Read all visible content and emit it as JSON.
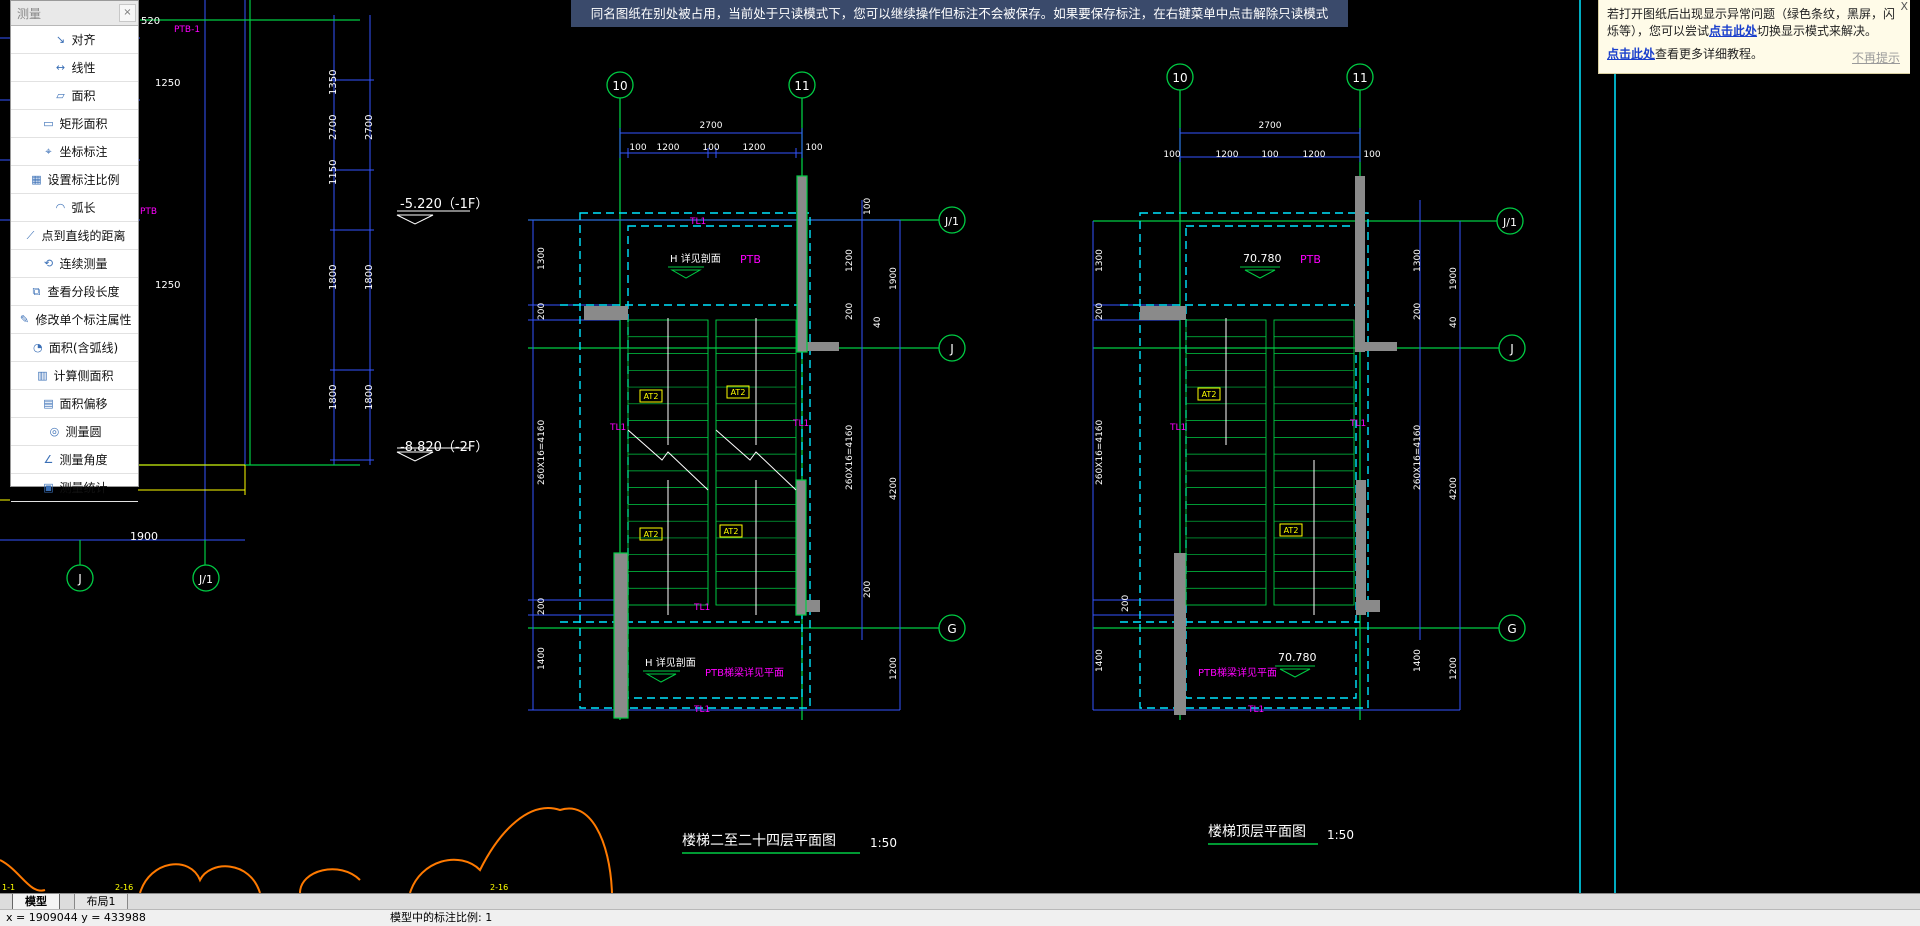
{
  "banner": {
    "text": "同名图纸在别处被占用，当前处于只读模式下，您可以继续操作但标注不会被保存。如果要保存标注，在右键菜单中点击解除只读模式"
  },
  "panel": {
    "title": "测量",
    "close": "×",
    "tools": [
      "对齐",
      "线性",
      "面积",
      "矩形面积",
      "坐标标注",
      "设置标注比例",
      "弧长",
      "点到直线的距离",
      "连续测量",
      "查看分段长度",
      "修改单个标注属性",
      "面积(含弧线)",
      "计算侧面积",
      "面积偏移",
      "测量圆",
      "测量角度",
      "测量统计"
    ]
  },
  "tip": {
    "line1": "若打开图纸后出现显示异常问题（绿色条纹，黑屏，闪烁等），您可以尝试",
    "link1": "点击此处",
    "line1b": "切换显示模式来解决。",
    "link2": "点击此处",
    "line2": "查看更多详细教程。",
    "nomore": "不再提示",
    "close": "X"
  },
  "drawing": {
    "left": {
      "elev1": "-5.220（-1F）",
      "elev2": "-8.820（-2F）",
      "dims": [
        "1250",
        "1250",
        "1350",
        "2700",
        "2700",
        "1150",
        "1800",
        "1800",
        "1800",
        "1800",
        "1900"
      ],
      "axes": [
        "J",
        "J/1"
      ],
      "partial": [
        "520",
        "PTB-1",
        "PTB"
      ]
    },
    "plan1": {
      "title": "楼梯二至二十四层平面图",
      "scale": "1:50",
      "axes": [
        "10",
        "11",
        "J/1",
        "J",
        "G"
      ],
      "top_dims": [
        "2700",
        "100",
        "1200",
        "100",
        "1200",
        "100"
      ],
      "left_dims": [
        "1300",
        "200",
        "260X16=4160",
        "200",
        "1400"
      ],
      "right_dims": [
        "100",
        "1200",
        "1900",
        "200",
        "40",
        "260X16=4160",
        "4200",
        "200",
        "1200"
      ],
      "labels": [
        "H 详见剖面",
        "PTB",
        "H 详见剖面",
        "PTB梯梁详见平面"
      ],
      "tags": [
        "AT2",
        "AT2",
        "AT2",
        "AT2"
      ]
    },
    "plan2": {
      "title": "楼梯顶层平面图",
      "scale": "1:50",
      "axes": [
        "10",
        "11",
        "J/1",
        "J",
        "G"
      ],
      "top_dims": [
        "2700",
        "100",
        "1200",
        "100",
        "1200",
        "100"
      ],
      "left_dims": [
        "1300",
        "200",
        "260X16=4160",
        "200",
        "1400"
      ],
      "right_dims": [
        "1300",
        "1900",
        "200",
        "40",
        "260X16=4160",
        "4200",
        "1400",
        "1200"
      ],
      "labels": [
        "70.780",
        "PTB",
        "PTB梯梁详见平面",
        "70.780"
      ],
      "tags": [
        "AT2",
        "AT2"
      ]
    }
  },
  "tabs": {
    "model": "模型",
    "layout": "布局1"
  },
  "status": {
    "coords": "x = 1909044  y = 433988",
    "scale": "模型中的标注比例: 1"
  },
  "colors": {
    "bg": "#000000",
    "green": "#00cc44",
    "cyan": "#00e5ff",
    "magenta": "#ff00ff",
    "blue": "#3355ff",
    "yellow": "#ffff00",
    "orange": "#ff7a00"
  }
}
